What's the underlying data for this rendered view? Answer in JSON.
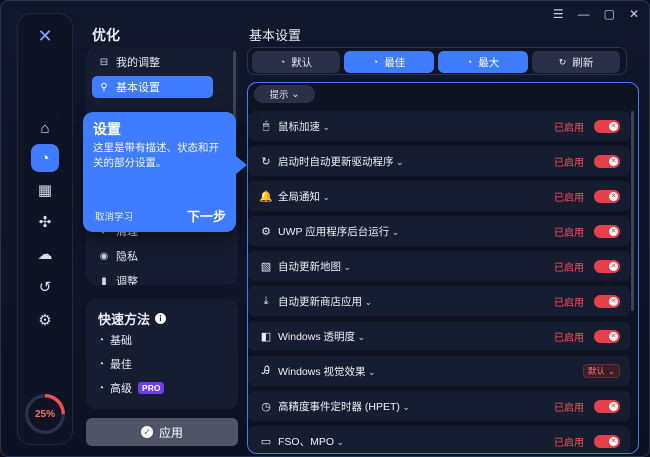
{
  "window": {
    "controls": [
      "☰",
      "—",
      "▢",
      "✕"
    ]
  },
  "rail": {
    "logo": "✕",
    "items": [
      {
        "icon": "home-icon",
        "glyph": "⌂"
      },
      {
        "icon": "speed-gauge-icon",
        "glyph": "◔",
        "active": true
      },
      {
        "icon": "apps-grid-icon",
        "glyph": "▦"
      },
      {
        "icon": "fan-icon",
        "glyph": "✣"
      },
      {
        "icon": "cloud-upload-icon",
        "glyph": "☁"
      },
      {
        "icon": "history-icon",
        "glyph": "↺"
      },
      {
        "icon": "gear-icon",
        "glyph": "⚙"
      }
    ],
    "gauge": {
      "value": "25%",
      "percent": 25
    }
  },
  "optimize": {
    "title": "优化",
    "menu": [
      {
        "label": "我的调整",
        "icon": "tweaks-icon",
        "glyph": "⊟"
      },
      {
        "label": "基本设置",
        "icon": "wrench-icon",
        "glyph": "⚲",
        "active": true
      },
      {
        "label": "清理",
        "icon": "clean-icon",
        "glyph": "◐"
      },
      {
        "label": "隐私",
        "icon": "privacy-icon",
        "glyph": "◉"
      },
      {
        "label": "调整",
        "icon": "adjust-icon",
        "glyph": "▮"
      }
    ]
  },
  "tooltip": {
    "title": "设置",
    "desc": "这里是带有描述、状态和开关的部分设置。",
    "skip": "取消学习",
    "next": "下一步"
  },
  "quick": {
    "title": "快速方法",
    "items": [
      {
        "label": "基础",
        "glyph": "◔"
      },
      {
        "label": "最佳",
        "glyph": "◔"
      },
      {
        "label": "高级",
        "glyph": "◔",
        "badge": "PRO"
      }
    ]
  },
  "apply": {
    "label": "应用"
  },
  "main": {
    "title": "基本设置",
    "presets": [
      {
        "label": "默认",
        "glyph": "◔"
      },
      {
        "label": "最佳",
        "glyph": "◔",
        "selected": true
      },
      {
        "label": "最大",
        "glyph": "◔",
        "selected": true
      },
      {
        "label": "刷新",
        "glyph": "↻"
      }
    ],
    "hint": "提示",
    "rows": [
      {
        "label": "鼠标加速",
        "glyph": "🖱",
        "status": "已启用",
        "control": "toggle"
      },
      {
        "label": "启动时自动更新驱动程序",
        "glyph": "↻",
        "status": "已启用",
        "control": "toggle"
      },
      {
        "label": "全局通知",
        "glyph": "🔔",
        "status": "已启用",
        "control": "toggle"
      },
      {
        "label": "UWP 应用程序后台运行",
        "glyph": "⚙",
        "status": "已启用",
        "control": "toggle"
      },
      {
        "label": "自动更新地图",
        "glyph": "▧",
        "status": "已启用",
        "control": "toggle"
      },
      {
        "label": "自动更新商店应用",
        "glyph": "⤓",
        "status": "已启用",
        "control": "toggle"
      },
      {
        "label": "Windows 透明度",
        "glyph": "◧",
        "status": "已启用",
        "control": "toggle"
      },
      {
        "label": "Windows 视觉效果",
        "glyph": "Ꭿ",
        "status": "",
        "control": "dropdown",
        "value": "默认"
      },
      {
        "label": "高精度事件定时器 (HPET)",
        "glyph": "◷",
        "status": "已启用",
        "control": "toggle"
      },
      {
        "label": "FSO、MPO",
        "glyph": "▭",
        "status": "已启用",
        "control": "toggle"
      }
    ]
  },
  "colors": {
    "accent": "#3f7cff",
    "danger": "#ff4d5a",
    "panel": "#171d31"
  }
}
